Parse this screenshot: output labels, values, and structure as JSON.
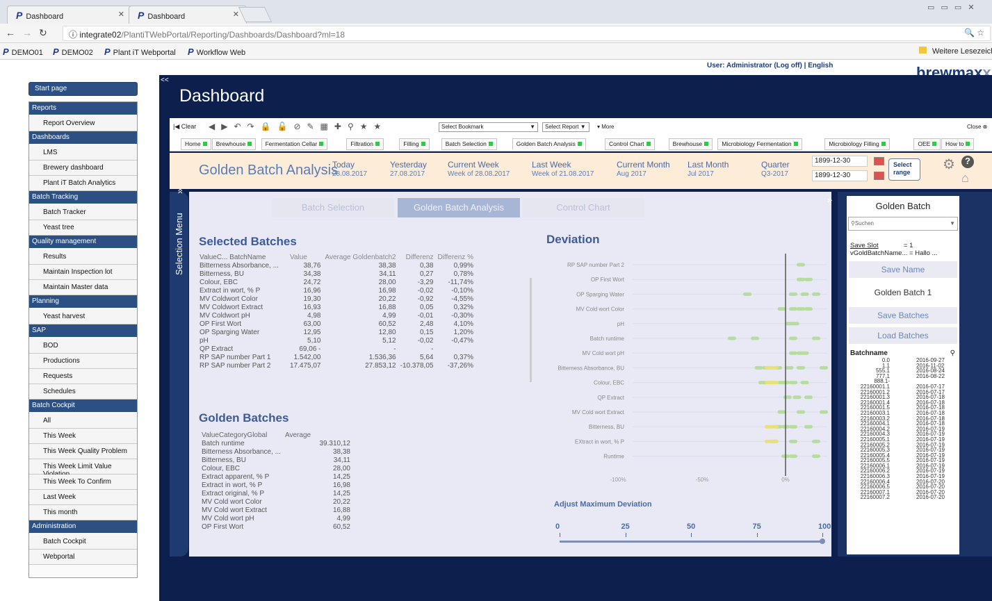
{
  "browser": {
    "tabs": [
      {
        "label": "Dashboard"
      },
      {
        "label": "Dashboard"
      }
    ],
    "url_host": "integrate02",
    "url_path": "/PlantiTWebPortal/Reporting/Dashboards/Dashboard?ml=18",
    "bookmarks": [
      "DEMO01",
      "DEMO02",
      "Plant iT Webportal",
      "Workflow Web"
    ],
    "other_bookmarks": "Weitere Lesezeichen"
  },
  "header": {
    "user_line": "User: Administrator (Log off)  |  English",
    "brand_main": "brewmax",
    "brand_x": "x",
    "page_title": "Dashboard"
  },
  "sidebar": {
    "start": "Start page",
    "items": [
      {
        "t": "h",
        "label": "Reports"
      },
      {
        "t": "i",
        "label": "Report Overview"
      },
      {
        "t": "h",
        "label": "Dashboards"
      },
      {
        "t": "i",
        "label": "LMS"
      },
      {
        "t": "i",
        "label": "Brewery dashboard"
      },
      {
        "t": "i",
        "label": "Plant iT Batch Analytics"
      },
      {
        "t": "h",
        "label": "Batch Tracking"
      },
      {
        "t": "i",
        "label": "Batch Tracker"
      },
      {
        "t": "i",
        "label": "Yeast tree"
      },
      {
        "t": "h",
        "label": "Quality management"
      },
      {
        "t": "i",
        "label": "Results"
      },
      {
        "t": "i",
        "label": "Maintain Inspection lot"
      },
      {
        "t": "i",
        "label": "Maintain Master data"
      },
      {
        "t": "h",
        "label": "Planning"
      },
      {
        "t": "i",
        "label": "Yeast harvest"
      },
      {
        "t": "h",
        "label": "SAP"
      },
      {
        "t": "i",
        "label": "BOD"
      },
      {
        "t": "i",
        "label": "Productions"
      },
      {
        "t": "i",
        "label": "Requests"
      },
      {
        "t": "i",
        "label": "Schedules"
      },
      {
        "t": "h",
        "label": "Batch Cockpit"
      },
      {
        "t": "i",
        "label": "All"
      },
      {
        "t": "i",
        "label": "This Week"
      },
      {
        "t": "i",
        "label": "This Week Quality Problem"
      },
      {
        "t": "i",
        "label": "This Week Limit Value Violation"
      },
      {
        "t": "i",
        "label": "This Week To Confirm"
      },
      {
        "t": "i",
        "label": "Last Week"
      },
      {
        "t": "i",
        "label": "This month"
      },
      {
        "t": "h",
        "label": "Administration"
      },
      {
        "t": "i",
        "label": "Batch Cockpit"
      },
      {
        "t": "i",
        "label": "Webportal"
      }
    ]
  },
  "toolbar": {
    "clear": "Clear",
    "bookmark_select": "Select Bookmark",
    "report_select": "Select Report",
    "more": "More",
    "close": "Close"
  },
  "qv_tabs": [
    {
      "label": "Home",
      "dot": true
    },
    {
      "label": "Brewhouse",
      "dot": true
    },
    {
      "label": "Fermentation Cellar",
      "dot": true
    },
    {
      "label": "Filtration",
      "dot": true
    },
    {
      "label": "Filling",
      "dot": true
    },
    {
      "label": "Batch Selection",
      "dot": true
    },
    {
      "label": "Golden Batch Analysis",
      "dot": true,
      "active": true
    },
    {
      "label": "Control Chart",
      "dot": true
    },
    {
      "label": "Brewhouse",
      "dot": true
    },
    {
      "label": "Microbiology Fermentation",
      "dot": true
    },
    {
      "label": "Microbiology Filling",
      "dot": true
    },
    {
      "label": "OEE",
      "dot": true
    },
    {
      "label": "How to",
      "dot": true
    }
  ],
  "period": {
    "title": "Golden Batch Analysis",
    "cols": [
      {
        "h": "Today",
        "s": "28.08.2017"
      },
      {
        "h": "Yesterday",
        "s": "27.08.2017"
      },
      {
        "h": "Current Week",
        "s": "Week of 28.08.2017"
      },
      {
        "h": "Last Week",
        "s": "Week of 21.08.2017"
      },
      {
        "h": "Current Month",
        "s": "Aug 2017"
      },
      {
        "h": "Last Month",
        "s": "Jul 2017"
      },
      {
        "h": "Quarter",
        "s": "Q3-2017"
      }
    ],
    "date_from": "1899-12-30",
    "date_to": "1899-12-30",
    "range_btn_1": "Select",
    "range_btn_2": "range"
  },
  "selection_menu": "Selection Menu",
  "sheet_tabs": [
    "Batch Selection",
    "Golden Batch Analysis",
    "Control Chart"
  ],
  "selected_batches": {
    "title": "Selected Batches",
    "headers": [
      "ValueC...",
      "BatchName",
      "Value",
      "Average Goldenbatch2",
      "Differenz",
      "Differenz %"
    ],
    "rows": [
      [
        "Bitterness Absorbance, ...",
        "38,76",
        "38,38",
        "0,38",
        "0,99%"
      ],
      [
        "Bitterness, BU",
        "34,38",
        "34,11",
        "0,27",
        "0,78%"
      ],
      [
        "Colour, EBC",
        "24,72",
        "28,00",
        "-3,29",
        "-11,74%"
      ],
      [
        "Extract in wort, % P",
        "16,96",
        "16,98",
        "-0,02",
        "-0,10%"
      ],
      [
        "MV Coldwort Color",
        "19,30",
        "20,22",
        "-0,92",
        "-4,55%"
      ],
      [
        "MV Coldwort Extract",
        "16,93",
        "16,88",
        "0,05",
        "0,32%"
      ],
      [
        "MV Coldwort pH",
        "4,98",
        "4,99",
        "-0,01",
        "-0,30%"
      ],
      [
        "OP First Wort",
        "63,00",
        "60,52",
        "2,48",
        "4,10%"
      ],
      [
        "OP Sparging Water",
        "12,95",
        "12,80",
        "0,15",
        "1,20%"
      ],
      [
        "pH",
        "5,10",
        "5,12",
        "-0,02",
        "-0,47%"
      ],
      [
        "QP Extract",
        "69,06 -",
        "-",
        "-",
        ""
      ],
      [
        "RP SAP number Part 1",
        "1.542,00",
        "1.536,36",
        "5,64",
        "0,37%"
      ],
      [
        "RP SAP number Part 2",
        "17.475,07",
        "27.853,12",
        "-10.378,05",
        "-37,26%"
      ]
    ]
  },
  "golden_batches": {
    "title": "Golden Batches",
    "headers": [
      "ValueCategoryGlobal",
      "Average"
    ],
    "rows": [
      [
        "Batch runtime",
        "39.310,12"
      ],
      [
        "Bitterness Absorbance, ...",
        "38,38"
      ],
      [
        "Bitterness, BU",
        "34,11"
      ],
      [
        "Colour, EBC",
        "28,00"
      ],
      [
        "Extract apparent, % P",
        "14,25"
      ],
      [
        "Extract in wort, % P",
        "16,98"
      ],
      [
        "Extract original, % P",
        "14,25"
      ],
      [
        "MV Cold wort Color",
        "20,22"
      ],
      [
        "MV Cold wort Extract",
        "16,88"
      ],
      [
        "MV Cold wort pH",
        "4,99"
      ],
      [
        "OP First Wort",
        "60,52"
      ]
    ]
  },
  "deviation": {
    "title": "Deviation",
    "categories": [
      "RP SAP number Part 2",
      "OP First Wort",
      "OP Sparging Water",
      "MV Cold wort Color",
      "pH",
      "Batch runtime",
      "MV Cold wort pH",
      "Bitterness Absorbance, BU",
      "Colour, EBC",
      "QP Extract",
      "MV Cold wort Extract",
      "Bitterness, BU",
      "EXtract in wort, % P",
      "Runtime"
    ],
    "x_ticks": [
      "-100%",
      "-50%",
      "0%"
    ],
    "adjust_label": "Adjust Maximum Deviation",
    "slider_ticks": [
      "0",
      "25",
      "50",
      "75",
      "100"
    ],
    "slider_value": 100
  },
  "right_panel": {
    "title": "Golden Batch",
    "search_placeholder": "Suchen",
    "save_slot_label": "Save Slot",
    "save_slot_value": "= 1",
    "vgold_label": "vGoldBatchName...",
    "vgold_value": "= Hallo ...",
    "save_name": "Save Name",
    "batch_name": "Golden Batch 1",
    "save_batches": "Save Batches",
    "load_batches": "Load Batches",
    "list_header": "Batchname",
    "batches": [
      [
        "0.0",
        "2016-09-27"
      ],
      [
        "1.1",
        "2016-11-02"
      ],
      [
        "555.1",
        "2016-08-24"
      ],
      [
        "777.1",
        "2016-08-22"
      ],
      [
        "888.1-",
        ""
      ],
      [
        "22160001.1",
        "2016-07-17"
      ],
      [
        "22160001.2",
        "2016-07-17"
      ],
      [
        "22160001.3",
        "2016-07-18"
      ],
      [
        "22160001.4",
        "2016-07-18"
      ],
      [
        "22160001.5",
        "2016-07-18"
      ],
      [
        "22160003.1",
        "2016-07-18"
      ],
      [
        "22160003.2",
        "2016-07-18"
      ],
      [
        "22160004.1",
        "2016-07-18"
      ],
      [
        "22160004.2",
        "2016-07-19"
      ],
      [
        "22160004.3",
        "2016-07-19"
      ],
      [
        "22160005.1",
        "2016-07-19"
      ],
      [
        "22160005.2",
        "2016-07-19"
      ],
      [
        "22160005.3",
        "2016-07-19"
      ],
      [
        "22160005.4",
        "2016-07-19"
      ],
      [
        "22160005.5",
        "2016-07-19"
      ],
      [
        "22160006.1",
        "2016-07-19"
      ],
      [
        "22160006.2",
        "2016-07-19"
      ],
      [
        "22160006.3",
        "2016-07-19"
      ],
      [
        "22160006.4",
        "2016-07-20"
      ],
      [
        "22160006.5",
        "2016-07-20"
      ],
      [
        "22160007.1",
        "2016-07-20"
      ],
      [
        "22160007.2",
        "2016-07-20"
      ]
    ]
  },
  "colors": {
    "navy": "#0d1f4c",
    "accent": "#2c4f84",
    "good": "#b7dca0",
    "warn": "#e8e07a"
  }
}
